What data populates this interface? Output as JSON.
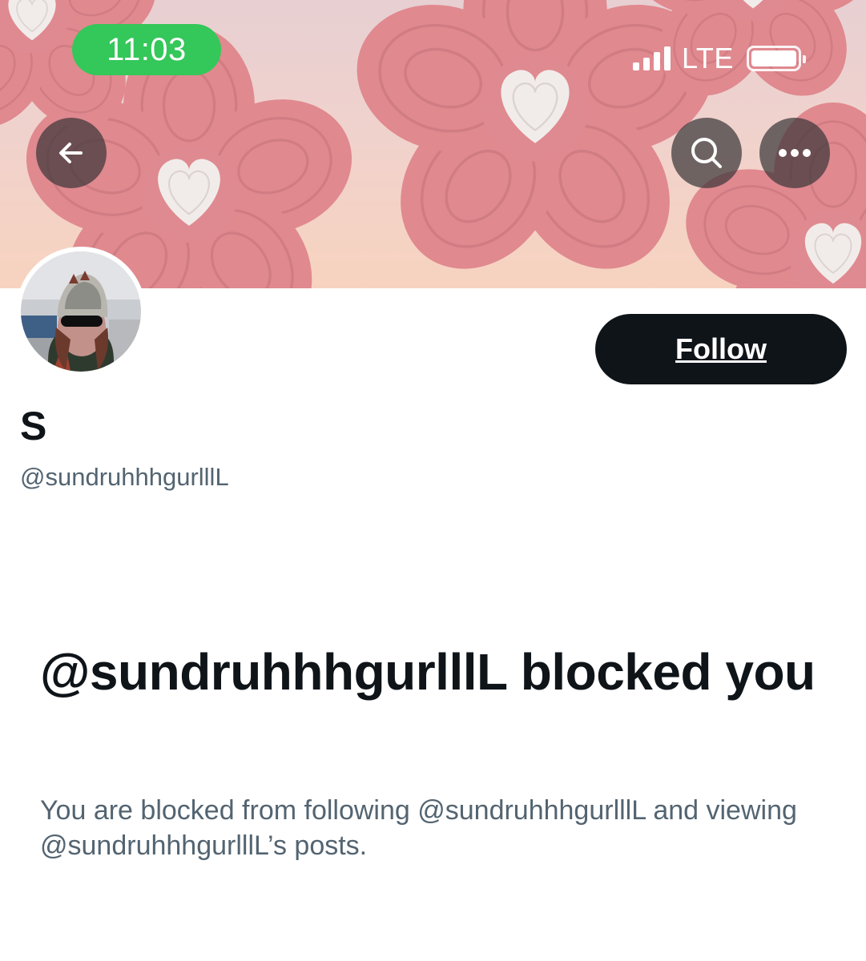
{
  "status_bar": {
    "time": "11:03",
    "network": "LTE",
    "time_pill_color": "#34c759"
  },
  "header": {
    "back_icon": "arrow-left-icon",
    "search_icon": "search-icon",
    "more_icon": "more-horizontal-icon"
  },
  "profile": {
    "display_name": "S",
    "handle": "@sundruhhhgurlllL",
    "follow_label": "Follow"
  },
  "blocked_notice": {
    "title": "@sundruhhhgurlllL blocked you",
    "description": "You are blocked from following @sundruhhhgurlllL and viewing @sundruhhhgurlllL’s posts."
  },
  "colors": {
    "text_primary": "#0f1419",
    "text_secondary": "#536471",
    "follow_button": "#0f1419",
    "banner_flower": "#e28f95"
  }
}
